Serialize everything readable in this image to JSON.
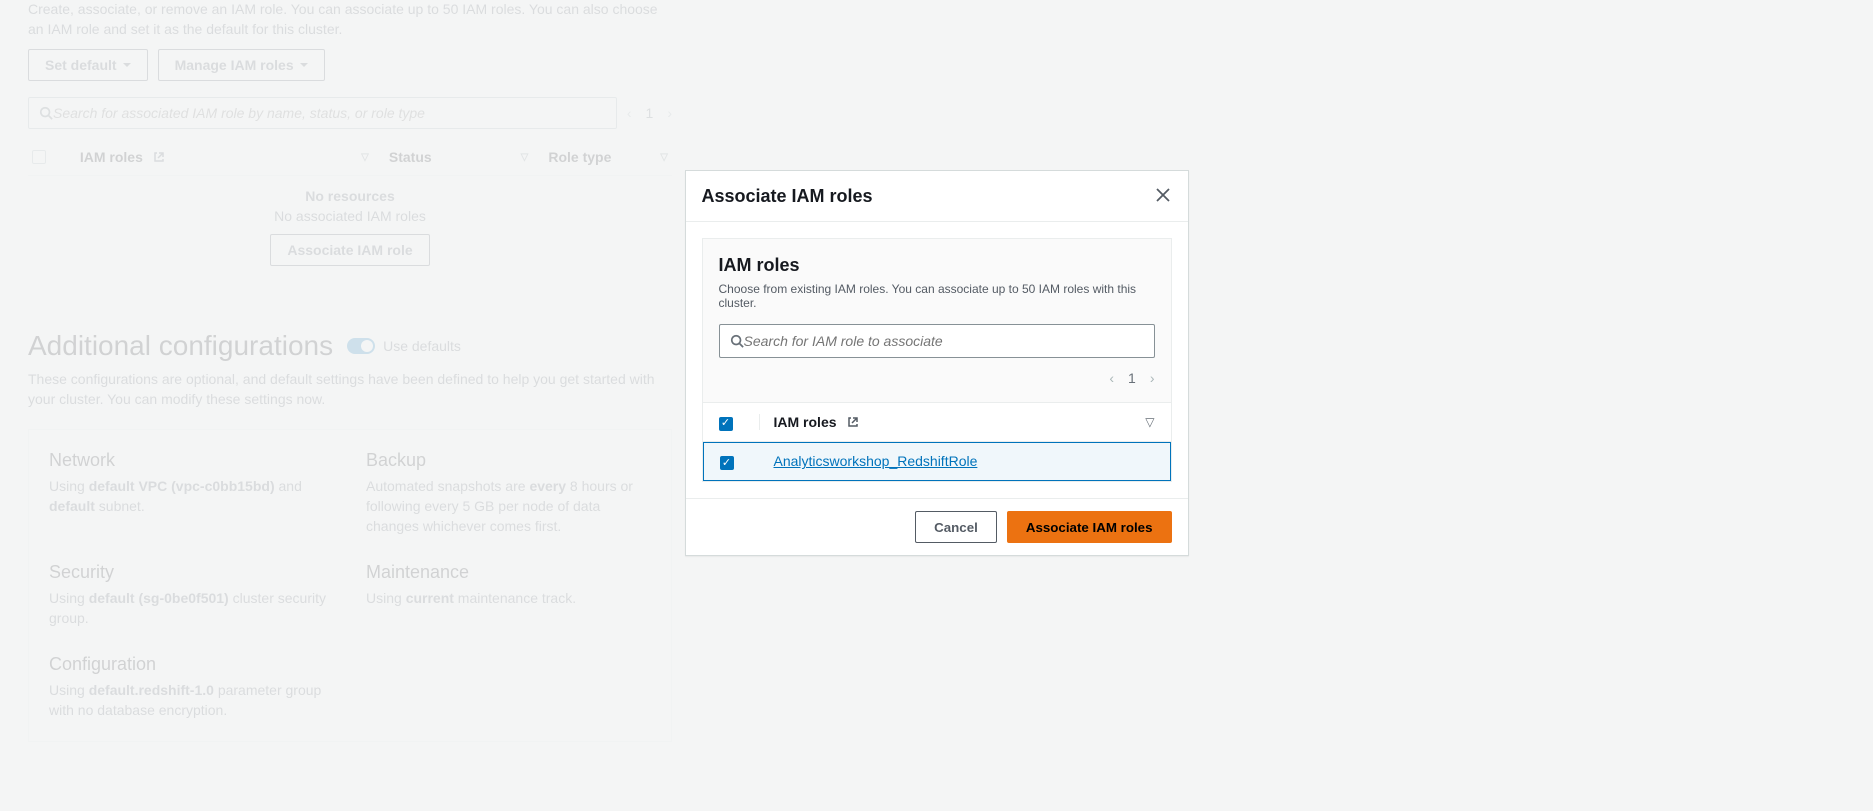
{
  "iam_panel": {
    "description": "Create, associate, or remove an IAM role. You can associate up to 50 IAM roles. You can also choose an IAM role and set it as the default for this cluster.",
    "set_default_button": "Set default",
    "manage_button": "Manage IAM roles",
    "search_placeholder": "Search for associated IAM role by name, status, or role type",
    "page_number": "1",
    "columns": {
      "iam_roles": "IAM roles",
      "status": "Status",
      "role_type": "Role type"
    },
    "empty": {
      "no_resources": "No resources",
      "no_associated": "No associated IAM roles",
      "associate_button": "Associate IAM role"
    }
  },
  "additional": {
    "title": "Additional configurations",
    "toggle_label": "Use defaults",
    "description": "These configurations are optional, and default settings have been defined to help you get started with your cluster. You can modify these settings now.",
    "blocks": {
      "network": {
        "title": "Network",
        "line1_pre": "Using ",
        "vpc": "default VPC (vpc-c0bb15bd)",
        "line1_mid": " and ",
        "subnet": "default",
        "line1_post": " subnet."
      },
      "backup": {
        "title": "Backup",
        "text_pre": "Automated snapshots are ",
        "interval": "every",
        "text_mid": " 8 hours or following every 5 GB per node of data changes whichever comes first."
      },
      "security": {
        "title": "Security",
        "line_pre": "Using ",
        "sg": "default (sg-0be0f501)",
        "line_post": " cluster security group."
      },
      "maintenance": {
        "title": "Maintenance",
        "line_pre": "Using ",
        "track": "current",
        "line_post": " maintenance track."
      },
      "configuration": {
        "title": "Configuration",
        "line_pre": "Using ",
        "pg": "default.redshift-1.0",
        "line_post": " parameter group with no database encryption."
      }
    }
  },
  "modal": {
    "title": "Associate IAM roles",
    "inner_title": "IAM roles",
    "inner_description": "Choose from existing IAM roles. You can associate up to 50 IAM roles with this cluster.",
    "search_placeholder": "Search for IAM role to associate",
    "page_number": "1",
    "column_label": "IAM roles",
    "row_role": "Analyticsworkshop_RedshiftRole",
    "cancel": "Cancel",
    "associate": "Associate IAM roles"
  }
}
